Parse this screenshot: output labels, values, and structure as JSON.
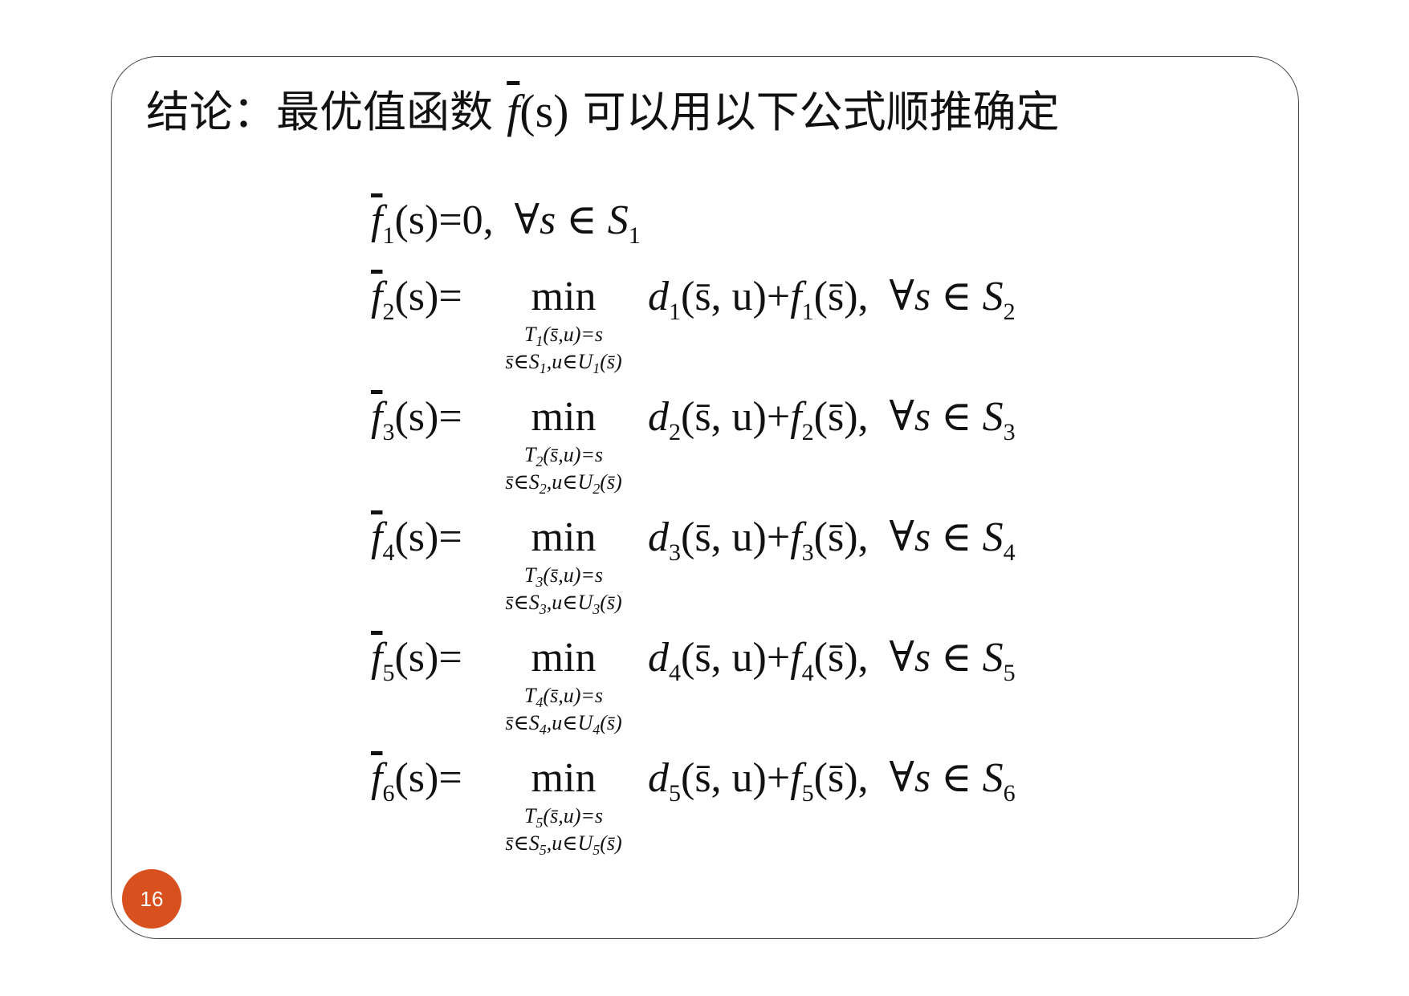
{
  "slide": {
    "title_prefix": "结论：最优值函数",
    "title_f": "f",
    "title_arg": "(s)",
    "title_suffix": "可以用以下公式顺推确定",
    "page_number": "16"
  },
  "formulas": [
    {
      "lhs_f": "f",
      "lhs_idx": "1",
      "lhs_arg": "(s)",
      "eq": "=",
      "value": "0,",
      "forall": "∀s ∈ S",
      "set_idx": "1"
    },
    {
      "lhs_f": "f",
      "lhs_idx": "2",
      "lhs_arg": "(s)",
      "eq": "=",
      "min": "min",
      "cond_top": "T",
      "cond_top_idx": "1",
      "cond_top_rest": "(s̄,u)=s",
      "cond_bot": "s̄∈S",
      "cond_bot_idx": "1",
      "cond_bot_rest": ",u∈U",
      "cond_bot_u_idx": "1",
      "cond_bot_end": "(s̄)",
      "d": "d",
      "d_idx": "1",
      "pair": "(s̄, u)",
      "plus": "+",
      "f": "f",
      "f_idx": "1",
      "f_arg": "(s̄),",
      "forall": "∀s ∈ S",
      "set_idx": "2"
    },
    {
      "lhs_f": "f",
      "lhs_idx": "3",
      "lhs_arg": "(s)",
      "eq": "=",
      "min": "min",
      "cond_top": "T",
      "cond_top_idx": "2",
      "cond_top_rest": "(s̄,u)=s",
      "cond_bot": "s̄∈S",
      "cond_bot_idx": "2",
      "cond_bot_rest": ",u∈U",
      "cond_bot_u_idx": "2",
      "cond_bot_end": "(s̄)",
      "d": "d",
      "d_idx": "2",
      "pair": "(s̄, u)",
      "plus": "+",
      "f": "f",
      "f_idx": "2",
      "f_arg": "(s̄),",
      "forall": "∀s ∈ S",
      "set_idx": "3"
    },
    {
      "lhs_f": "f",
      "lhs_idx": "4",
      "lhs_arg": "(s)",
      "eq": "=",
      "min": "min",
      "cond_top": "T",
      "cond_top_idx": "3",
      "cond_top_rest": "(s̄,u)=s",
      "cond_bot": "s̄∈S",
      "cond_bot_idx": "3",
      "cond_bot_rest": ",u∈U",
      "cond_bot_u_idx": "3",
      "cond_bot_end": "(s̄)",
      "d": "d",
      "d_idx": "3",
      "pair": "(s̄, u)",
      "plus": "+",
      "f": "f",
      "f_idx": "3",
      "f_arg": "(s̄),",
      "forall": "∀s ∈ S",
      "set_idx": "4"
    },
    {
      "lhs_f": "f",
      "lhs_idx": "5",
      "lhs_arg": "(s)",
      "eq": "=",
      "min": "min",
      "cond_top": "T",
      "cond_top_idx": "4",
      "cond_top_rest": "(s̄,u)=s",
      "cond_bot": "s̄∈S",
      "cond_bot_idx": "4",
      "cond_bot_rest": ",u∈U",
      "cond_bot_u_idx": "4",
      "cond_bot_end": "(s̄)",
      "d": "d",
      "d_idx": "4",
      "pair": "(s̄, u)",
      "plus": "+",
      "f": "f",
      "f_idx": "4",
      "f_arg": "(s̄),",
      "forall": "∀s ∈ S",
      "set_idx": "5"
    },
    {
      "lhs_f": "f",
      "lhs_idx": "6",
      "lhs_arg": "(s)",
      "eq": "=",
      "min": "min",
      "cond_top": "T",
      "cond_top_idx": "5",
      "cond_top_rest": "(s̄,u)=s",
      "cond_bot": "s̄∈S",
      "cond_bot_idx": "5",
      "cond_bot_rest": ",u∈U",
      "cond_bot_u_idx": "5",
      "cond_bot_end": "(s̄)",
      "d": "d",
      "d_idx": "5",
      "pair": "(s̄, u)",
      "plus": "+",
      "f": "f",
      "f_idx": "5",
      "f_arg": "(s̄),",
      "forall": "∀s ∈ S",
      "set_idx": "6"
    }
  ]
}
